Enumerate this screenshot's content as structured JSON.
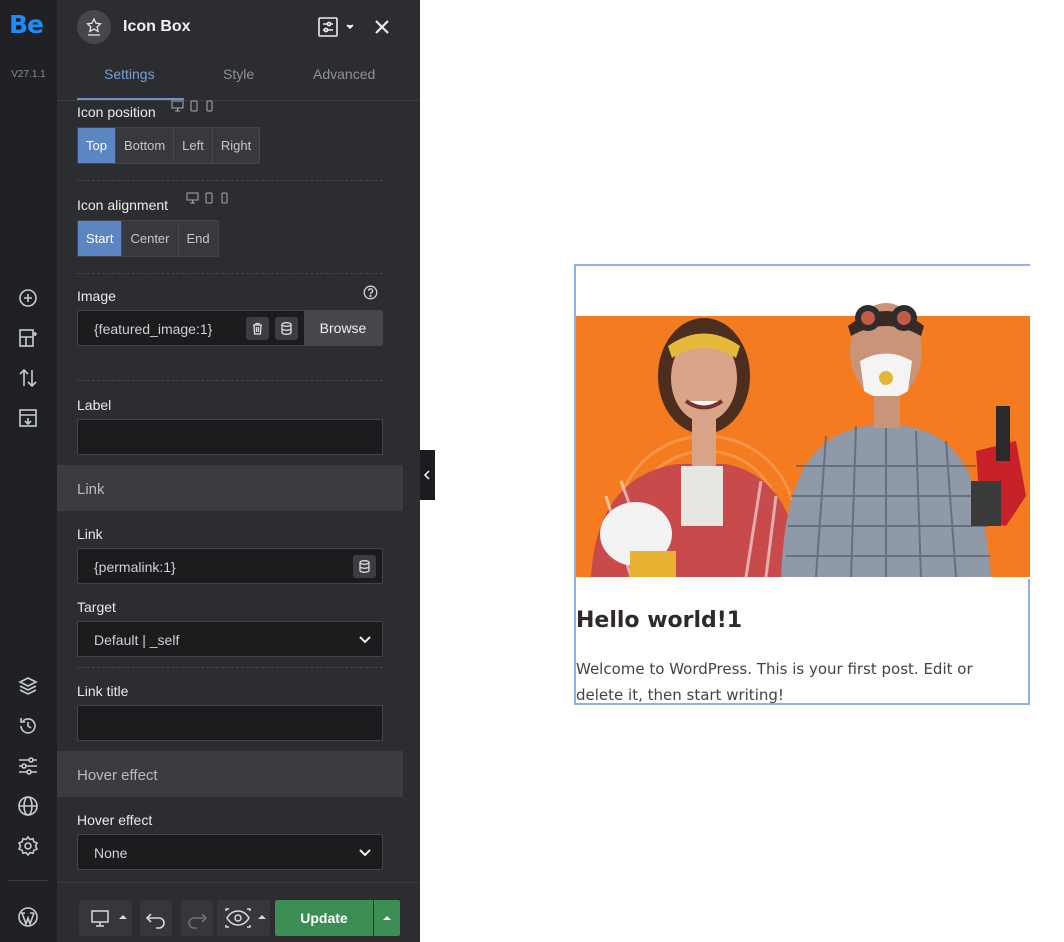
{
  "rail": {
    "logo": "Be",
    "version": "V27.1.1",
    "icons": [
      "add-element-icon",
      "templates-icon",
      "sort-icon",
      "import-icon",
      "layers-icon",
      "history-icon",
      "options-icon",
      "globe-icon",
      "settings-icon",
      "wordpress-icon"
    ]
  },
  "panel": {
    "title": "Icon Box",
    "tabs": [
      "Settings",
      "Style",
      "Advanced"
    ],
    "active_tab": "Settings",
    "icon_position": {
      "label": "Icon position",
      "options": [
        "Top",
        "Bottom",
        "Left",
        "Right"
      ],
      "selected": "Top"
    },
    "icon_alignment": {
      "label": "Icon alignment",
      "options": [
        "Start",
        "Center",
        "End"
      ],
      "selected": "Start"
    },
    "image": {
      "label": "Image",
      "value": "{featured_image:1}",
      "browse": "Browse"
    },
    "label_field": {
      "label": "Label",
      "value": ""
    },
    "link_section": {
      "title": "Link"
    },
    "link": {
      "label": "Link",
      "value": "{permalink:1}"
    },
    "target": {
      "label": "Target",
      "value": "Default | _self"
    },
    "link_title": {
      "label": "Link title",
      "value": ""
    },
    "hover_section": {
      "title": "Hover effect"
    },
    "hover": {
      "label": "Hover effect",
      "value": "None"
    }
  },
  "bottom_bar": {
    "update": "Update"
  },
  "preview": {
    "title": "Hello world!1",
    "text": "Welcome to WordPress. This is your first post. Edit or delete it, then start writing!"
  },
  "colors": {
    "accent": "#5b86c2",
    "update": "#3c8e54",
    "logo": "#1d8bf8",
    "orange": "#f47b1f"
  }
}
